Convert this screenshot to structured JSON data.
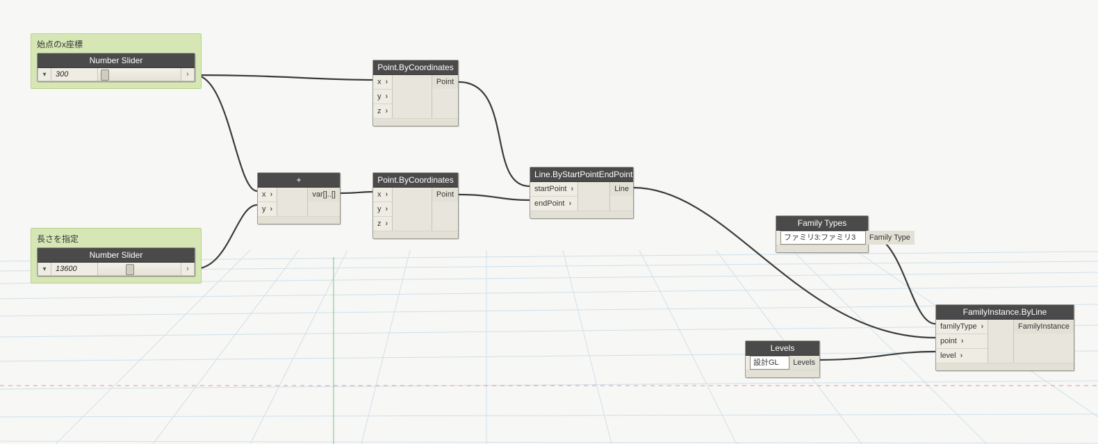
{
  "groups": [
    {
      "title": "始点のx座標",
      "slider": {
        "title": "Number Slider",
        "value": "300"
      }
    },
    {
      "title": "長さを指定",
      "slider": {
        "title": "Number Slider",
        "value": "13600"
      }
    }
  ],
  "nodes": {
    "add": {
      "title": "+",
      "inputs": [
        "x",
        "y"
      ],
      "outputs": [
        "var[]..[]"
      ]
    },
    "point1": {
      "title": "Point.ByCoordinates",
      "inputs": [
        "x",
        "y",
        "z"
      ],
      "outputs": [
        "Point"
      ]
    },
    "point2": {
      "title": "Point.ByCoordinates",
      "inputs": [
        "x",
        "y",
        "z"
      ],
      "outputs": [
        "Point"
      ]
    },
    "line": {
      "title": "Line.ByStartPointEndPoint",
      "inputs": [
        "startPoint",
        "endPoint"
      ],
      "outputs": [
        "Line"
      ]
    },
    "familyTypes": {
      "title": "Family Types",
      "selected": "ファミリ3:ファミリ3",
      "outputs": [
        "Family Type"
      ]
    },
    "levels": {
      "title": "Levels",
      "selected": "設計GL",
      "outputs": [
        "Levels"
      ]
    },
    "familyInstance": {
      "title": "FamilyInstance.ByLine",
      "inputs": [
        "familyType",
        "point",
        "level"
      ],
      "outputs": [
        "FamilyInstance"
      ]
    }
  },
  "connections": [
    {
      "from": "slider1.out",
      "to": "point1.x"
    },
    {
      "from": "slider1.out",
      "to": "add.x"
    },
    {
      "from": "slider2.out",
      "to": "add.y"
    },
    {
      "from": "add.out",
      "to": "point2.x"
    },
    {
      "from": "point1.Point",
      "to": "line.startPoint"
    },
    {
      "from": "point2.Point",
      "to": "line.endPoint"
    },
    {
      "from": "line.Line",
      "to": "familyInstance.point"
    },
    {
      "from": "familyTypes.FamilyType",
      "to": "familyInstance.familyType"
    },
    {
      "from": "levels.Levels",
      "to": "familyInstance.level"
    }
  ]
}
